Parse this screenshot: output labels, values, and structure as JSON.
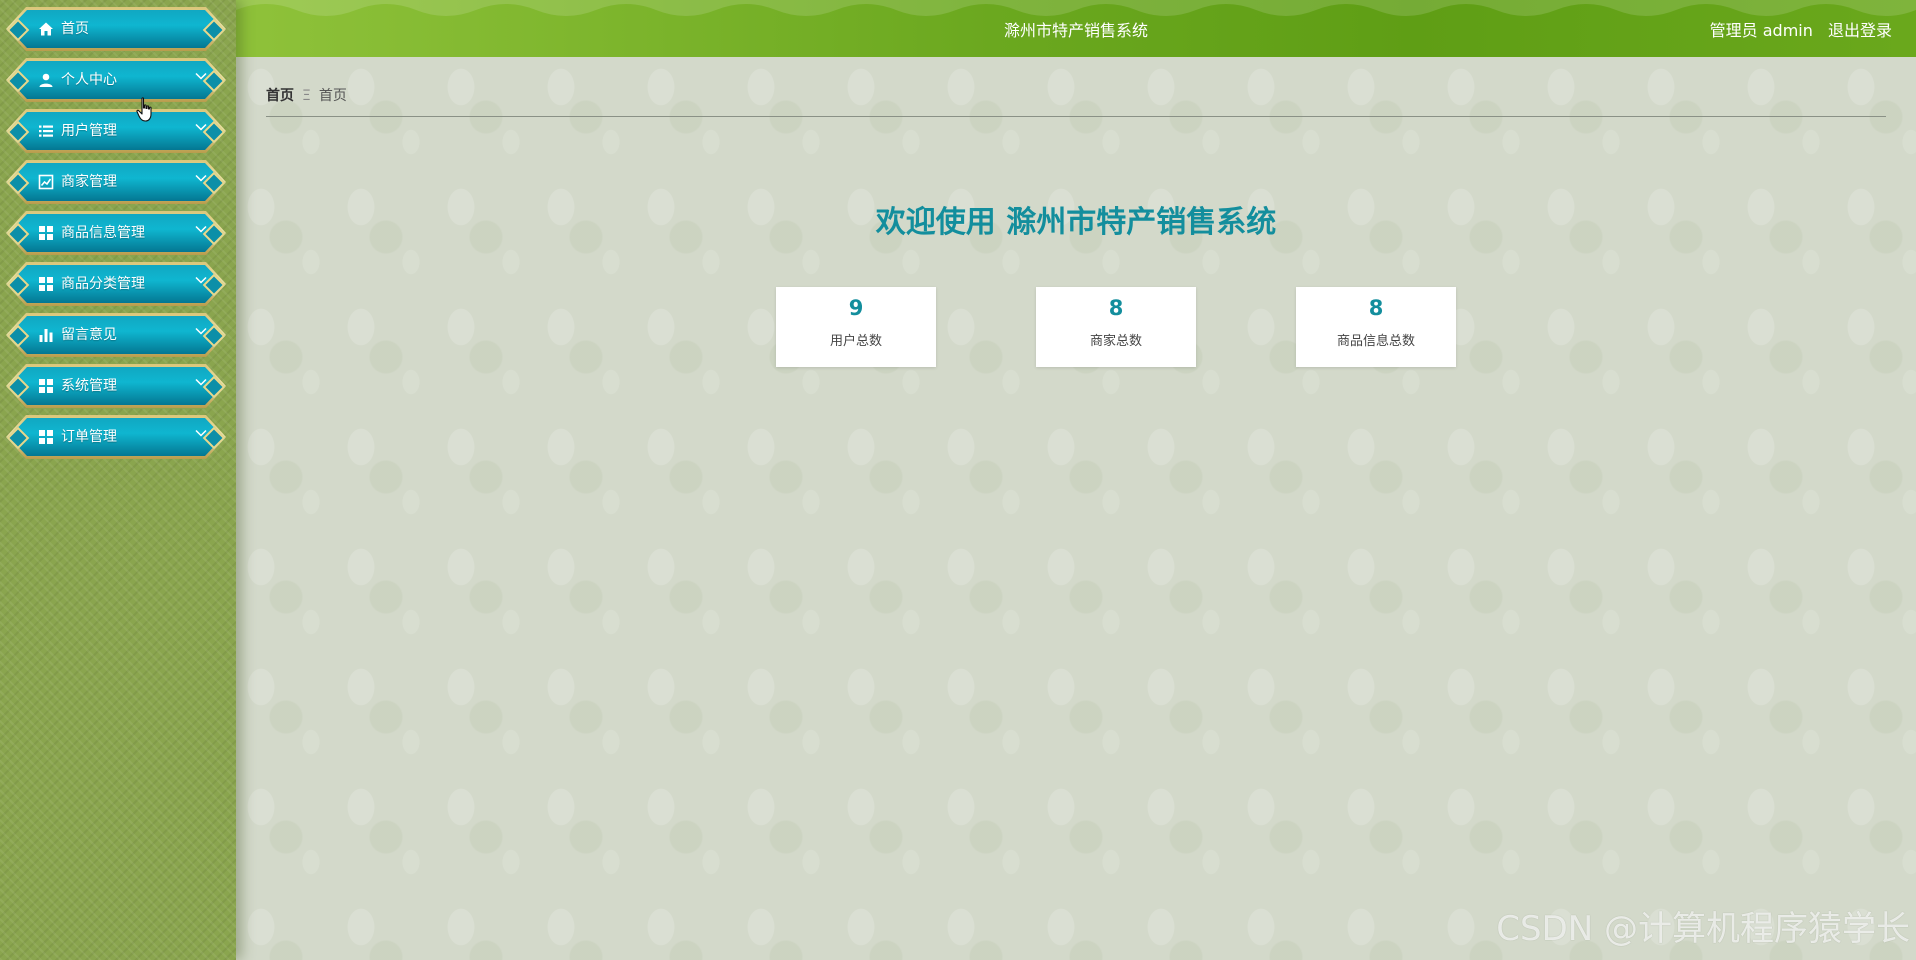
{
  "header": {
    "title": "滁州市特产销售系统",
    "user": "管理员 admin",
    "logout": "退出登录"
  },
  "sidebar": {
    "items": [
      {
        "label": "首页",
        "icon": "home-icon",
        "has_chevron": false
      },
      {
        "label": "个人中心",
        "icon": "user-icon",
        "has_chevron": true
      },
      {
        "label": "用户管理",
        "icon": "list-icon",
        "has_chevron": true
      },
      {
        "label": "商家管理",
        "icon": "chart-line-icon",
        "has_chevron": true
      },
      {
        "label": "商品信息管理",
        "icon": "grid-icon",
        "has_chevron": true
      },
      {
        "label": "商品分类管理",
        "icon": "grid-icon",
        "has_chevron": true
      },
      {
        "label": "留言意见",
        "icon": "bar-chart-icon",
        "has_chevron": true
      },
      {
        "label": "系统管理",
        "icon": "grid-icon",
        "has_chevron": true
      },
      {
        "label": "订单管理",
        "icon": "grid-icon",
        "has_chevron": true
      }
    ]
  },
  "breadcrumb": {
    "root": "首页",
    "separator": "Ξ",
    "current": "首页"
  },
  "main": {
    "welcome": "欢迎使用 滁州市特产销售系统",
    "stats": [
      {
        "value": "9",
        "label": "用户总数"
      },
      {
        "value": "8",
        "label": "商家总数"
      },
      {
        "value": "8",
        "label": "商品信息总数"
      }
    ]
  },
  "watermark": "CSDN @计算机程序猿学长",
  "colors": {
    "accent": "#138e9d",
    "header_green": "#6ba81f",
    "sidebar_green": "#8aa54e",
    "menu_teal": "#0fb6d0",
    "menu_gold": "#e8d88c"
  }
}
